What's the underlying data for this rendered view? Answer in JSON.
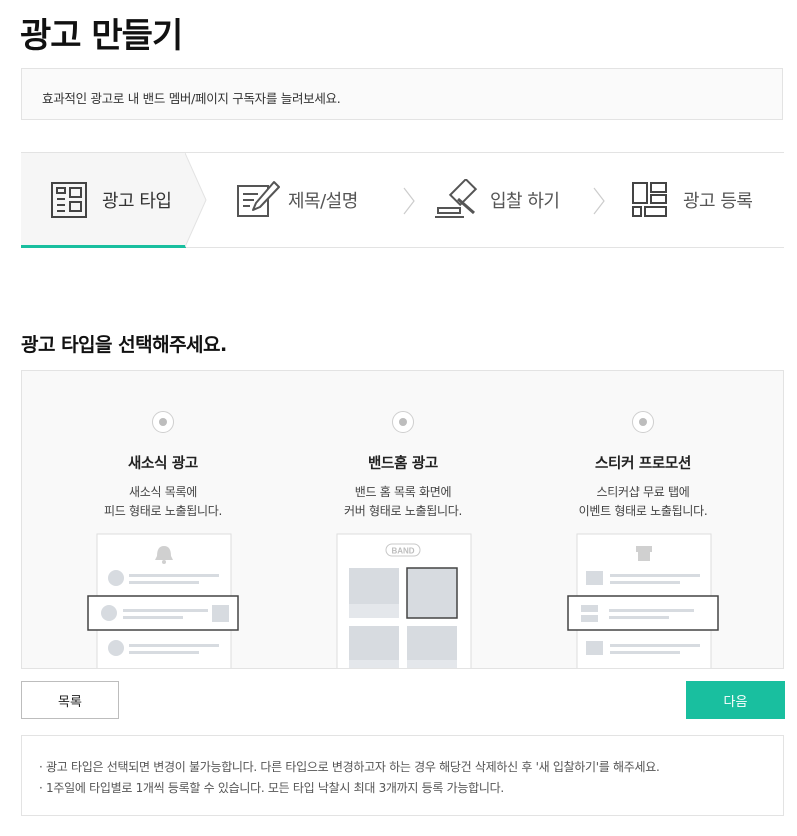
{
  "header": {
    "title": "광고 만들기"
  },
  "intro": "효과적인 광고로 내 밴드 멤버/페이지 구독자를 늘려보세요.",
  "steps": [
    {
      "label": "광고 타입",
      "icon": "layout-icon",
      "active": true
    },
    {
      "label": "제목/설명",
      "icon": "edit-icon",
      "active": false
    },
    {
      "label": "입찰 하기",
      "icon": "gavel-icon",
      "active": false
    },
    {
      "label": "광고 등록",
      "icon": "grid-icon",
      "active": false
    }
  ],
  "section_title": "광고 타입을 선택해주세요.",
  "ad_types": [
    {
      "title": "새소식 광고",
      "desc_line1": "새소식 목록에",
      "desc_line2": "피드 형태로 노출됩니다."
    },
    {
      "title": "밴드홈 광고",
      "desc_line1": "밴드 홈 목록 화면에",
      "desc_line2": "커버 형태로 노출됩니다.",
      "preview_badge": "BAND"
    },
    {
      "title": "스티커 프로모션",
      "desc_line1": "스티커샵 무료 탭에",
      "desc_line2": "이벤트 형태로 노출됩니다."
    }
  ],
  "buttons": {
    "list": "목록",
    "next": "다음"
  },
  "notices": [
    "· 광고 타입은 선택되면 변경이 불가능합니다. 다른 타입으로 변경하고자 하는 경우 해당건 삭제하신 후 '새 입찰하기'를 해주세요.",
    "· 1주일에 타입별로 1개씩 등록할 수 있습니다. 모든 타입 낙찰시 최대 3개까지 등록 가능합니다."
  ],
  "colors": {
    "accent": "#19bf9f",
    "border": "#e3e3e3",
    "panel_bg": "#f9f9f9"
  }
}
